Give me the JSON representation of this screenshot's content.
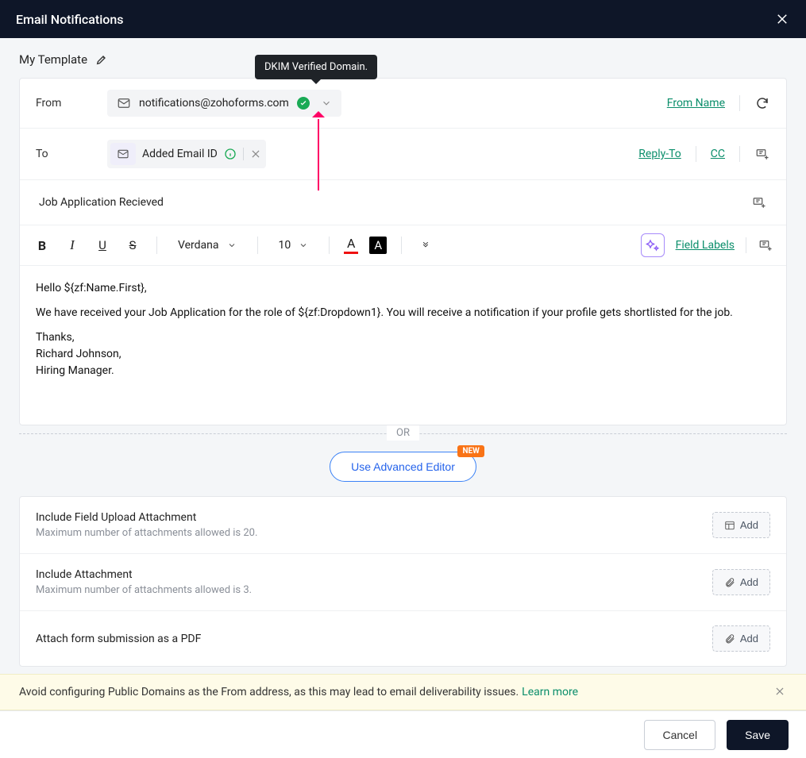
{
  "topbar": {
    "title": "Email Notifications"
  },
  "template": {
    "name": "My Template"
  },
  "tooltip": {
    "dkim": "DKIM Verified Domain."
  },
  "from": {
    "label": "From",
    "email": "notifications@zohoforms.com",
    "link_from_name": "From Name"
  },
  "to": {
    "label": "To",
    "pill": "Added Email ID",
    "reply_to": "Reply-To",
    "cc": "CC"
  },
  "subject": {
    "text": "Job Application Recieved"
  },
  "toolbar": {
    "font": "Verdana",
    "size": "10",
    "field_labels": "Field Labels"
  },
  "body": {
    "line1": "Hello ${zf:Name.First},",
    "line2": "We have received your Job Application for the role of ${zf:Dropdown1}. You will receive a notification if your profile gets shortlisted for the job.",
    "line3": "Thanks,",
    "line4": "Richard Johnson,",
    "line5": "Hiring Manager."
  },
  "divider": {
    "or": "OR"
  },
  "advanced": {
    "button": "Use Advanced Editor",
    "badge": "NEW"
  },
  "attach": {
    "items": [
      {
        "title": "Include Field Upload Attachment",
        "sub": "Maximum number of attachments allowed is 20.",
        "add": "Add",
        "icon": "attach-field"
      },
      {
        "title": "Include Attachment",
        "sub": "Maximum number of attachments allowed is 3.",
        "add": "Add",
        "icon": "paperclip"
      },
      {
        "title": "Attach form submission as a PDF",
        "sub": "",
        "add": "Add",
        "icon": "paperclip"
      }
    ]
  },
  "banner": {
    "text": "Avoid configuring Public Domains as the From address, as this may lead to email deliverability issues.",
    "learn": "Learn more"
  },
  "footer": {
    "cancel": "Cancel",
    "save": "Save"
  }
}
